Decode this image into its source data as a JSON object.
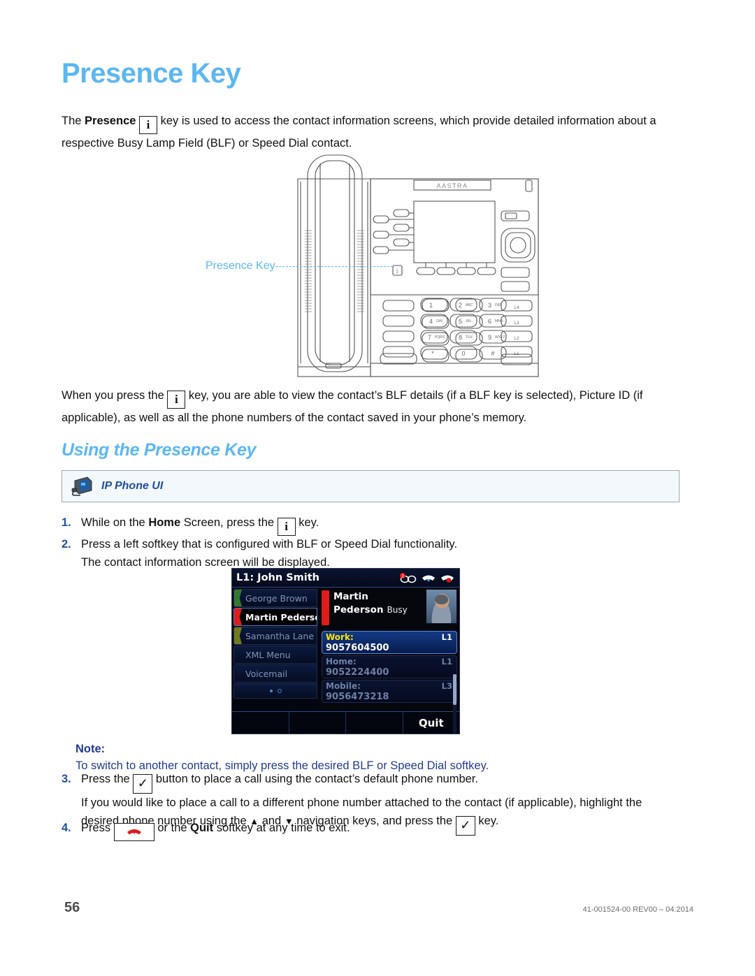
{
  "page": {
    "title": "Presence Key",
    "number": "56",
    "doc_reference": "41-001524-00 REV00 – 04.2014",
    "heading_color": "#5BB7F0",
    "note_color": "#1F3A93"
  },
  "intro": {
    "p1_a": "The ",
    "p1_bold": "Presence",
    "p1_key_glyph": "i",
    "p1_b": " key is used to access the contact information screens, which provide detailed information about a respective Busy Lamp Field (BLF) or Speed Dial contact."
  },
  "figure": {
    "callout_label": "Presence Key",
    "keypad_rows": [
      [
        {
          "digit": "1",
          "letters": ""
        },
        {
          "digit": "2",
          "letters": "ABC"
        },
        {
          "digit": "3",
          "letters": "DEF"
        }
      ],
      [
        {
          "digit": "4",
          "letters": "GHI"
        },
        {
          "digit": "5",
          "letters": "JKL"
        },
        {
          "digit": "6",
          "letters": "MNO"
        }
      ],
      [
        {
          "digit": "7",
          "letters": "PQRS"
        },
        {
          "digit": "8",
          "letters": "TUV"
        },
        {
          "digit": "9",
          "letters": "WXYZ"
        }
      ],
      [
        {
          "digit": "*",
          "letters": ""
        },
        {
          "digit": "0",
          "letters": ""
        },
        {
          "digit": "#",
          "letters": ""
        }
      ]
    ],
    "line_keys": [
      "L4",
      "L3",
      "L2",
      "L1"
    ],
    "brand": "AASTRA"
  },
  "middle": {
    "a": "When you press the ",
    "key_glyph": "i",
    "b": " key, you are able to view the contact’s BLF details (if a BLF key is selected), Picture ID (if applicable), as well as all the phone numbers of the contact saved in your phone’s memory."
  },
  "section": {
    "heading": "Using the Presence Key"
  },
  "banner": {
    "label": "IP Phone UI"
  },
  "steps": {
    "one": {
      "num": "1.",
      "a": "While on the ",
      "bold": "Home",
      "b": " Screen, press the ",
      "key_glyph": "i",
      "c": " key."
    },
    "two": {
      "num": "2.",
      "line1": "Press a left softkey that is configured with BLF or Speed Dial functionality.",
      "line2": "The contact information screen will be displayed."
    },
    "three": {
      "num": "3.",
      "a": "Press the ",
      "key_glyph": "✓",
      "b": " button to place a call using the contact’s default phone number.",
      "line2": "If you would like to place a call to a different phone number attached to the contact (if applicable), highlight the",
      "line3_a": "desired phone number using the ",
      "up_arrow": "▲",
      "line3_b": " and ",
      "down_arrow": "▼",
      "line3_c": " navigation keys, and press the ",
      "line3_d": " key."
    },
    "four": {
      "num": "4.",
      "a": "Press ",
      "b": " or the ",
      "bold": "Quit",
      "c": " softkey at any time to exit."
    }
  },
  "note": {
    "title": "Note:",
    "text": "To switch to another contact, simply press the desired BLF or Speed Dial softkey."
  },
  "phone_screen": {
    "line_label": "L1: John Smith",
    "status_icons": [
      "voicemail-icon",
      "incoming-call-icon",
      "missed-call-icon"
    ],
    "voicemail_count": "3",
    "softkeys": [
      {
        "label": "George Brown",
        "blf_color": "#2f7a2f",
        "selected": false
      },
      {
        "label": "Martin Pederson",
        "blf_color": "#e01b1b",
        "selected": true
      },
      {
        "label": "Samantha Lane",
        "blf_color": "#6f7a1e",
        "selected": false
      },
      {
        "label": "XML Menu",
        "blf_color": "",
        "selected": false
      },
      {
        "label": "Voicemail",
        "blf_color": "",
        "selected": false
      }
    ],
    "contact": {
      "first_name": "Martin",
      "last_name": "Pederson",
      "presence_status": "Busy",
      "status_color": "#e01b1b"
    },
    "numbers": [
      {
        "label": "Work:",
        "value": "9057604500",
        "line": "L1",
        "active": true
      },
      {
        "label": "Home:",
        "value": "9052224400",
        "line": "L1",
        "active": false
      },
      {
        "label": "Mobile:",
        "value": "9056473218",
        "line": "L3",
        "active": false
      }
    ],
    "bottom_softkeys": [
      "",
      "",
      "",
      "Quit"
    ]
  }
}
